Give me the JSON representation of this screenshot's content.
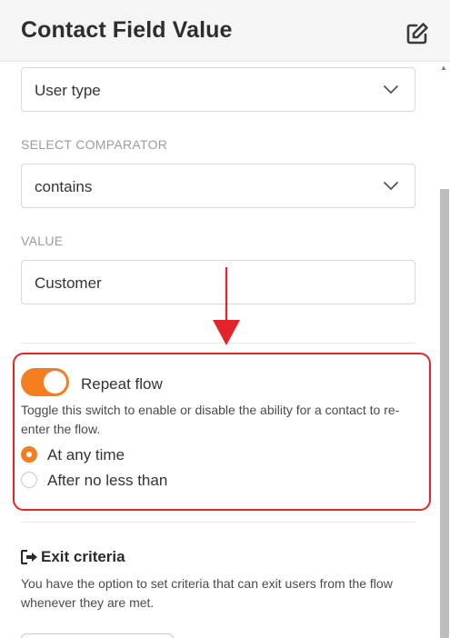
{
  "header": {
    "title": "Contact Field Value"
  },
  "field_select": {
    "value": "User type"
  },
  "comparator": {
    "label": "SELECT COMPARATOR",
    "value": "contains"
  },
  "value_field": {
    "label": "VALUE",
    "value": "Customer"
  },
  "repeat_flow": {
    "label": "Repeat flow",
    "enabled": true,
    "help": "Toggle this switch to enable or disable the ability for a contact to re-enter the flow.",
    "options": [
      {
        "label": "At any time",
        "selected": true
      },
      {
        "label": "After no less than",
        "selected": false
      }
    ]
  },
  "exit_criteria": {
    "title": "Exit criteria",
    "description": "You have the option to set criteria that can exit users from the flow whenever they are met."
  },
  "colors": {
    "accent": "#f47e1f",
    "highlight": "#e5232a"
  }
}
